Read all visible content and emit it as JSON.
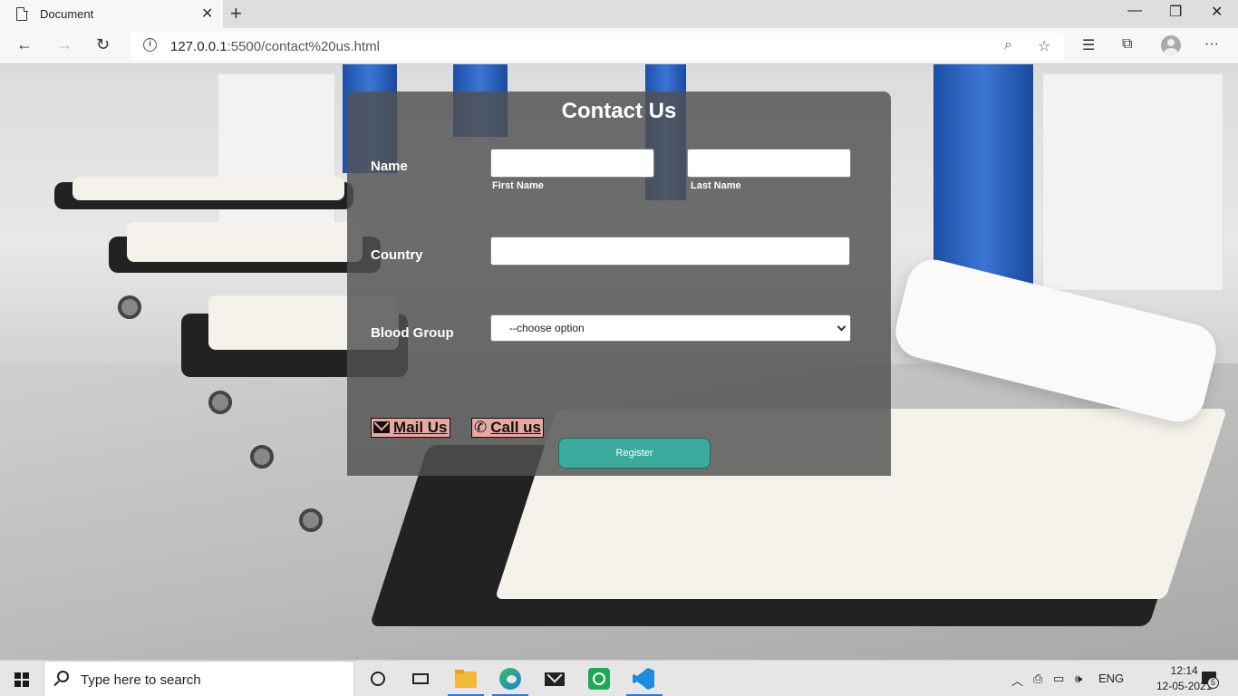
{
  "browser": {
    "tab_title": "Document",
    "tab_close": "✕",
    "new_tab": "+",
    "url_host": "127.0.0.1",
    "url_rest": ":5500/contact%20us.html",
    "window_controls": {
      "minimize": "—",
      "restore": "❐",
      "close": "✕"
    },
    "icons": [
      "back-icon",
      "forward-icon",
      "refresh-icon",
      "info-icon",
      "zoom-icon",
      "favorite-star-icon",
      "favorites-icon",
      "collections-icon",
      "profile-icon",
      "more-icon"
    ]
  },
  "form": {
    "title": "Contact Us",
    "name_label": "Name",
    "first_name_label": "First Name",
    "last_name_label": "Last Name",
    "first_name_value": "",
    "last_name_value": "",
    "country_label": "Country",
    "country_value": "",
    "blood_group_label": "Blood Group",
    "blood_group_selected": "--choose option",
    "mail_label": "Mail Us",
    "call_label": "Call us",
    "register_label": "Register"
  },
  "taskbar": {
    "search_placeholder": "Type here to search",
    "language": "ENG",
    "time": "12:14",
    "date": "12-05-2021",
    "notification_count": "5",
    "apps": [
      "cortana-icon",
      "task-view-icon",
      "file-explorer-icon",
      "edge-icon",
      "mail-icon",
      "whatsapp-icon",
      "vscode-icon"
    ]
  },
  "colors": {
    "register_button": "#3aab9c",
    "link_button_bg": "#e8a9a3",
    "panel_bg": "rgba(80,80,80,0.82)",
    "taskbar_active": "#2d7ad6"
  }
}
